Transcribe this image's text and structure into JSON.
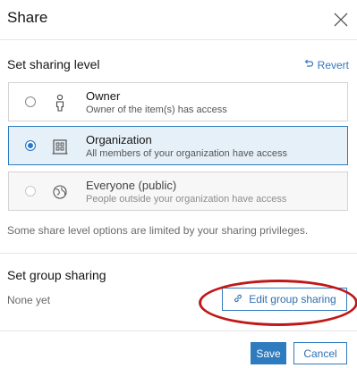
{
  "dialog": {
    "title": "Share"
  },
  "sharing_level": {
    "label": "Set sharing level",
    "revert_label": "Revert",
    "options": [
      {
        "title": "Owner",
        "description": "Owner of the item(s) has access",
        "icon": "person-icon",
        "selected": false,
        "disabled": false
      },
      {
        "title": "Organization",
        "description": "All members of your organization have access",
        "icon": "organization-icon",
        "selected": true,
        "disabled": false
      },
      {
        "title": "Everyone (public)",
        "description": "People outside your organization have access",
        "icon": "globe-icon",
        "selected": false,
        "disabled": true
      }
    ],
    "note": "Some share level options are limited by your sharing privileges."
  },
  "group_sharing": {
    "label": "Set group sharing",
    "status": "None yet",
    "edit_label": "Edit group sharing"
  },
  "footer": {
    "save_label": "Save",
    "cancel_label": "Cancel"
  },
  "colors": {
    "accent": "#2f7bbf",
    "selected_bg": "#e6f0f8",
    "annotation": "#c01818"
  }
}
